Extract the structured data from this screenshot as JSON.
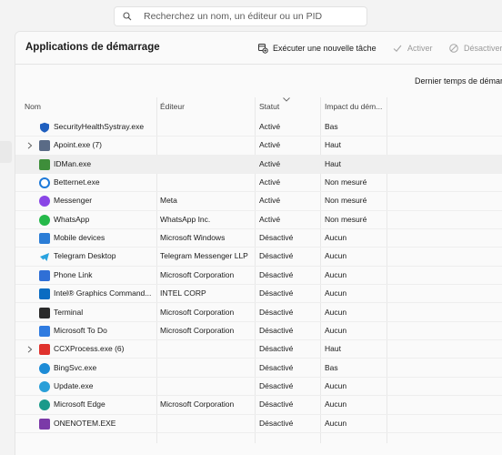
{
  "search": {
    "placeholder": "Recherchez un nom, un éditeur ou un PID"
  },
  "header": {
    "title": "Applications de démarrage",
    "run_task": "Exécuter une nouvelle tâche",
    "enable": "Activer",
    "disable": "Désactiver"
  },
  "last_boot_label": "Dernier temps de démarrage",
  "columns": {
    "name": "Nom",
    "publisher": "Éditeur",
    "status": "Statut",
    "impact": "Impact du dém..."
  },
  "rows": [
    {
      "name": "SecurityHealthSystray.exe",
      "publisher": "",
      "status": "Activé",
      "impact": "Bas",
      "icon": "shield-icon",
      "color": "#1f5fbf"
    },
    {
      "name": "Apoint.exe (7)",
      "publisher": "",
      "status": "Activé",
      "impact": "Haut",
      "icon": "window-icon",
      "color": "#5a6b86",
      "expandable": true
    },
    {
      "name": "IDMan.exe",
      "publisher": "",
      "status": "Activé",
      "impact": "Haut",
      "icon": "idm-icon",
      "color": "#3e8e3a",
      "highlighted": true
    },
    {
      "name": "Betternet.exe",
      "publisher": "",
      "status": "Activé",
      "impact": "Non mesuré",
      "icon": "ring-icon",
      "color": "#1e7ad9"
    },
    {
      "name": "Messenger",
      "publisher": "Meta",
      "status": "Activé",
      "impact": "Non mesuré",
      "icon": "messenger-icon",
      "color": "#8a46e6"
    },
    {
      "name": "WhatsApp",
      "publisher": "WhatsApp Inc.",
      "status": "Activé",
      "impact": "Non mesuré",
      "icon": "whatsapp-icon",
      "color": "#25b94a"
    },
    {
      "name": "Mobile devices",
      "publisher": "Microsoft Windows",
      "status": "Désactivé",
      "impact": "Aucun",
      "icon": "phone-icon",
      "color": "#2b7dd6"
    },
    {
      "name": "Telegram Desktop",
      "publisher": "Telegram Messenger LLP",
      "status": "Désactivé",
      "impact": "Aucun",
      "icon": "telegram-icon",
      "color": "#2aa3df"
    },
    {
      "name": "Phone Link",
      "publisher": "Microsoft Corporation",
      "status": "Désactivé",
      "impact": "Aucun",
      "icon": "phone-link-icon",
      "color": "#2f6fd6"
    },
    {
      "name": "Intel® Graphics Command...",
      "publisher": "INTEL CORP",
      "status": "Désactivé",
      "impact": "Aucun",
      "icon": "intel-icon",
      "color": "#0a6cc2"
    },
    {
      "name": "Terminal",
      "publisher": "Microsoft Corporation",
      "status": "Désactivé",
      "impact": "Aucun",
      "icon": "terminal-icon",
      "color": "#2b2b2b"
    },
    {
      "name": "Microsoft To Do",
      "publisher": "Microsoft Corporation",
      "status": "Désactivé",
      "impact": "Aucun",
      "icon": "todo-icon",
      "color": "#2f7be0"
    },
    {
      "name": "CCXProcess.exe (6)",
      "publisher": "",
      "status": "Désactivé",
      "impact": "Haut",
      "icon": "adobe-icon",
      "color": "#e0322d",
      "expandable": true
    },
    {
      "name": "BingSvc.exe",
      "publisher": "",
      "status": "Désactivé",
      "impact": "Bas",
      "icon": "bing-icon",
      "color": "#1c8bd6"
    },
    {
      "name": "Update.exe",
      "publisher": "",
      "status": "Désactivé",
      "impact": "Aucun",
      "icon": "update-icon",
      "color": "#2a9fd8"
    },
    {
      "name": "Microsoft Edge",
      "publisher": "Microsoft Corporation",
      "status": "Désactivé",
      "impact": "Aucun",
      "icon": "edge-icon",
      "color": "#1a9a8a"
    },
    {
      "name": "ONENOTEM.EXE",
      "publisher": "",
      "status": "Désactivé",
      "impact": "Aucun",
      "icon": "onenote-icon",
      "color": "#7b3aa8"
    }
  ]
}
